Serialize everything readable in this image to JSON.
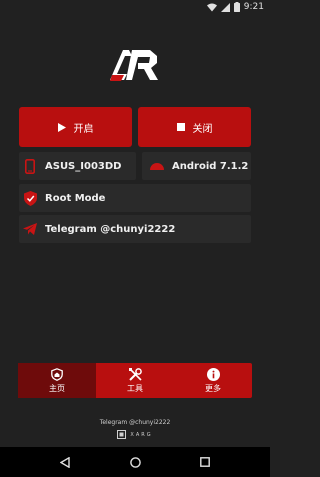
{
  "status_bar": {
    "time": "9:21",
    "icons": [
      "wifi-icon",
      "signal-icon",
      "battery-icon"
    ]
  },
  "logo": {
    "text": "AR",
    "icon": "ar-logo"
  },
  "actions": {
    "start_label": "开启",
    "stop_label": "关闭"
  },
  "device": {
    "model": "ASUS_I003DD",
    "android_version": "Android 7.1.2",
    "root_status": "Root Mode",
    "telegram": "Telegram @chunyi2222"
  },
  "tabs": [
    {
      "label": "主页",
      "icon": "home-shield-icon",
      "active": true
    },
    {
      "label": "工具",
      "icon": "tools-icon",
      "active": false
    },
    {
      "label": "更多",
      "icon": "info-icon",
      "active": false
    }
  ],
  "footer": {
    "telegram_line": "Telegram @chunyi2222",
    "brand": "XARG"
  },
  "colors": {
    "accent": "#b80f0f",
    "background": "#212121",
    "tab_active": "#6e0b0b"
  },
  "navbar": {
    "icons": [
      "back-icon",
      "home-icon",
      "recents-icon"
    ]
  }
}
